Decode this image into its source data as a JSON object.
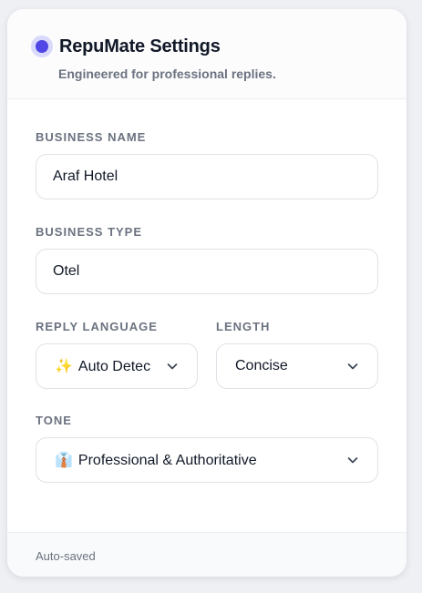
{
  "header": {
    "title": "RepuMate Settings",
    "subtitle": "Engineered for professional replies."
  },
  "business_name": {
    "label": "BUSINESS NAME",
    "value": "Araf Hotel"
  },
  "business_type": {
    "label": "BUSINESS TYPE",
    "value": "Otel"
  },
  "reply_language": {
    "label": "REPLY LANGUAGE",
    "emoji": "✨",
    "value": "Auto Detec"
  },
  "length": {
    "label": "LENGTH",
    "value": "Concise"
  },
  "tone": {
    "label": "TONE",
    "emoji": "👔",
    "value": "Professional & Authoritative"
  },
  "footer": {
    "status": "Auto-saved"
  },
  "colors": {
    "accent": "#5046e5",
    "accent_soft": "#d8d9fb",
    "text": "#111827",
    "muted": "#6b7280",
    "border": "#dfe2e7"
  }
}
